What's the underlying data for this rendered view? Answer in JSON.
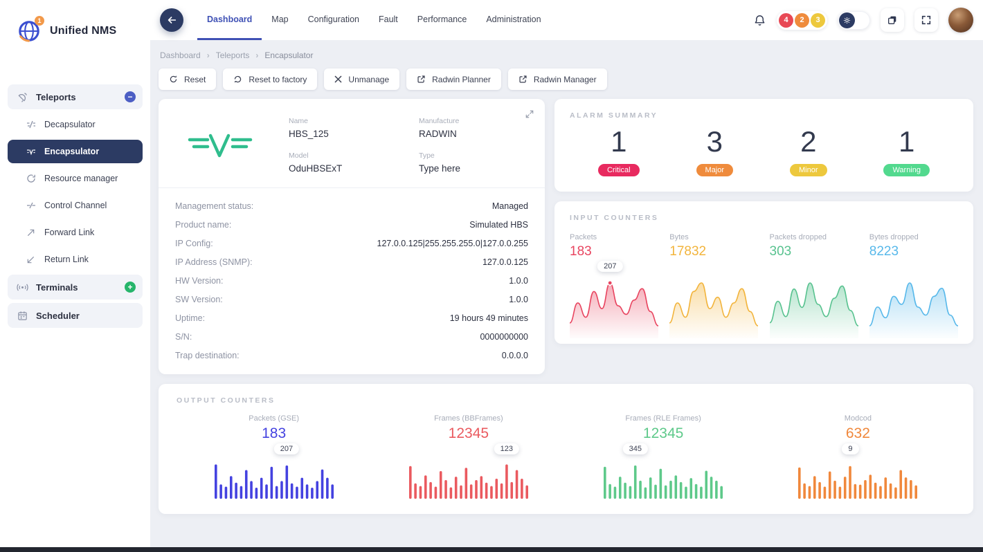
{
  "app": {
    "name": "Unified NMS",
    "logo_badge": "1"
  },
  "topbar": {
    "tabs": [
      {
        "label": "Dashboard",
        "active": true
      },
      {
        "label": "Map",
        "active": false
      },
      {
        "label": "Configuration",
        "active": false
      },
      {
        "label": "Fault",
        "active": false
      },
      {
        "label": "Performance",
        "active": false
      },
      {
        "label": "Administration",
        "active": false
      }
    ],
    "alarm_badges": [
      {
        "count": "4",
        "color": "#e84855"
      },
      {
        "count": "2",
        "color": "#ef8b3c"
      },
      {
        "count": "3",
        "color": "#edc83d"
      }
    ]
  },
  "breadcrumb": {
    "items": [
      "Dashboard",
      "Teleports",
      "Encapsulator"
    ],
    "separator": "›"
  },
  "toolbar": {
    "buttons": [
      {
        "label": "Reset",
        "icon": "refresh-icon"
      },
      {
        "label": "Reset to factory",
        "icon": "factory-reset-icon"
      },
      {
        "label": "Unmanage",
        "icon": "close-icon"
      },
      {
        "label": "Radwin Planner",
        "icon": "external-link-icon"
      },
      {
        "label": "Radwin Manager",
        "icon": "external-link-icon"
      }
    ]
  },
  "sidebar": {
    "items": [
      {
        "label": "Teleports",
        "toggle": "minus",
        "children": [
          {
            "label": "Decapsulator",
            "active": false
          },
          {
            "label": "Encapsulator",
            "active": true
          },
          {
            "label": "Resource manager",
            "active": false
          },
          {
            "label": "Control Channel",
            "active": false
          },
          {
            "label": "Forward Link",
            "active": false
          },
          {
            "label": "Return Link",
            "active": false
          }
        ]
      },
      {
        "label": "Terminals",
        "toggle": "plus",
        "children": []
      },
      {
        "label": "Scheduler",
        "toggle": "none",
        "children": []
      }
    ]
  },
  "device": {
    "header_fields": [
      {
        "label": "Name",
        "value": "HBS_125"
      },
      {
        "label": "Manufacture",
        "value": "RADWIN"
      },
      {
        "label": "Model",
        "value": "OduHBSExT"
      },
      {
        "label": "Type",
        "value": "Type here"
      }
    ],
    "details": [
      {
        "label": "Management status:",
        "value": "Managed"
      },
      {
        "label": "Product name:",
        "value": "Simulated HBS"
      },
      {
        "label": "IP Config:",
        "value": "127.0.0.125|255.255.255.0|127.0.0.255"
      },
      {
        "label": "IP Address (SNMP):",
        "value": "127.0.0.125"
      },
      {
        "label": "HW Version:",
        "value": "1.0.0"
      },
      {
        "label": "SW Version:",
        "value": "1.0.0"
      },
      {
        "label": "Uptime:",
        "value": "19 hours 49 minutes"
      },
      {
        "label": "S/N:",
        "value": "0000000000"
      },
      {
        "label": "Trap destination:",
        "value": "0.0.0.0"
      }
    ]
  },
  "alarm_summary": {
    "title": "ALARM SUMMARY",
    "items": [
      {
        "count": "1",
        "label": "Critical",
        "color": "#e82a5f"
      },
      {
        "count": "3",
        "label": "Major",
        "color": "#ef8b3c"
      },
      {
        "count": "2",
        "label": "Minor",
        "color": "#edc83d"
      },
      {
        "count": "1",
        "label": "Warning",
        "color": "#52d98e"
      }
    ]
  },
  "chart_data": [
    {
      "id": "input_counters",
      "type": "area",
      "title": "INPUT COUNTERS",
      "series": [
        {
          "name": "Packets",
          "value": "183",
          "color": "#e8445f",
          "marker_label": "207",
          "marker_index": 5,
          "values": [
            62,
            76,
            66,
            84,
            72,
            90,
            74,
            68,
            78,
            86,
            70,
            60
          ]
        },
        {
          "name": "Bytes",
          "value": "17832",
          "color": "#f2b43c",
          "values": [
            58,
            72,
            62,
            80,
            86,
            68,
            76,
            62,
            72,
            82,
            66,
            56
          ]
        },
        {
          "name": "Packets dropped",
          "value": "303",
          "color": "#58c28f",
          "values": [
            60,
            74,
            64,
            82,
            70,
            86,
            72,
            64,
            76,
            84,
            68,
            58
          ]
        },
        {
          "name": "Bytes dropped",
          "value": "8223",
          "color": "#57b8ea",
          "values": [
            56,
            70,
            62,
            78,
            72,
            88,
            70,
            64,
            78,
            84,
            64,
            56
          ]
        }
      ]
    },
    {
      "id": "output_counters",
      "type": "bar",
      "title": "OUTPUT COUNTERS",
      "series": [
        {
          "name": "Packets (GSE)",
          "value": "183",
          "color": "#4442e0",
          "marker_label": "207",
          "marker_index": 14,
          "values": [
            95,
            35,
            28,
            60,
            40,
            30,
            78,
            45,
            25,
            55,
            35,
            88,
            30,
            45,
            92,
            38,
            28,
            55,
            35,
            25,
            45,
            80,
            55,
            35
          ]
        },
        {
          "name": "Frames (BBFrames)",
          "value": "12345",
          "color": "#ea5a5f",
          "marker_label": "123",
          "marker_index": 19,
          "values": [
            90,
            38,
            30,
            62,
            42,
            28,
            75,
            48,
            26,
            58,
            32,
            85,
            35,
            48,
            60,
            40,
            30,
            52,
            38,
            95,
            42,
            78,
            52,
            32
          ]
        },
        {
          "name": "Frames (RLE Frames)",
          "value": "12345",
          "color": "#5ec98a",
          "marker_label": "345",
          "marker_index": 6,
          "values": [
            88,
            36,
            28,
            58,
            40,
            30,
            92,
            46,
            26,
            56,
            34,
            82,
            32,
            46,
            62,
            42,
            28,
            54,
            36,
            28,
            76,
            58,
            46,
            30
          ]
        },
        {
          "name": "Modcod",
          "value": "632",
          "color": "#f0883c",
          "marker_label": "9",
          "marker_index": 10,
          "values": [
            86,
            38,
            30,
            60,
            42,
            28,
            74,
            46,
            28,
            58,
            90,
            36,
            34,
            48,
            64,
            40,
            30,
            56,
            38,
            26,
            78,
            56,
            48,
            32
          ]
        }
      ]
    }
  ]
}
